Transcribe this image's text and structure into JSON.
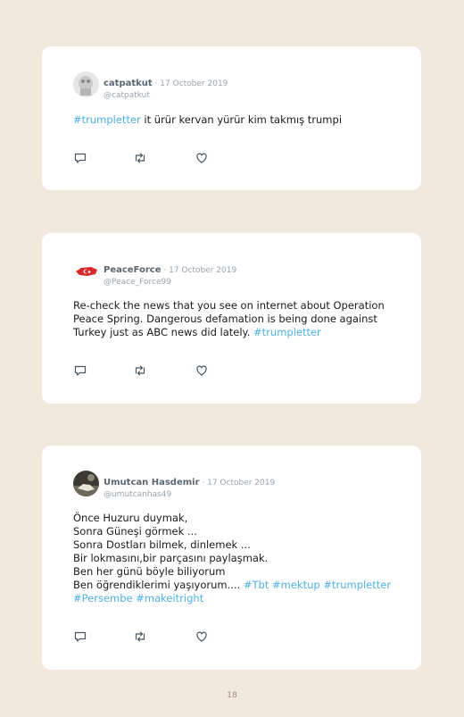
{
  "tweets": [
    {
      "name": "catpatkut",
      "sep": " · ",
      "date": "17 October 2019",
      "handle": "@catpatkut",
      "lines": [
        [
          {
            "t": "#trumpletter",
            "h": true
          },
          {
            "t": " it ürür kervan yürür kim takmış trumpi",
            "h": false
          }
        ]
      ]
    },
    {
      "name": "PeaceForce",
      "sep": " · ",
      "date": "17 October 2019",
      "handle": "@Peace_Force99",
      "lines": [
        [
          {
            "t": "Re-check the news that you see on internet about Operation",
            "h": false
          }
        ],
        [
          {
            "t": "Peace Spring. Dangerous defamation is being done against",
            "h": false
          }
        ],
        [
          {
            "t": "Turkey just as ABC news did lately. ",
            "h": false
          },
          {
            "t": "#trumpletter",
            "h": true
          }
        ]
      ]
    },
    {
      "name": "Umutcan Hasdemir",
      "sep": " · ",
      "date": "17 October 2019",
      "handle": "@umutcanhas49",
      "lines": [
        [
          {
            "t": "Önce Huzuru duymak,",
            "h": false
          }
        ],
        [
          {
            "t": "Sonra Güneşi görmek ...",
            "h": false
          }
        ],
        [
          {
            "t": "Sonra Dostları bilmek, dinlemek ...",
            "h": false
          }
        ],
        [
          {
            "t": "Bir lokmasını,bir parçasını paylaşmak.",
            "h": false
          }
        ],
        [
          {
            "t": "Ben her günü böyle biliyorum",
            "h": false
          }
        ],
        [
          {
            "t": "Ben öğrendiklerimi yaşıyorum.... ",
            "h": false
          },
          {
            "t": "#Tbt #mektup #trumpletter",
            "h": true
          }
        ],
        [
          {
            "t": "#Persembe #makeitright",
            "h": true
          }
        ]
      ]
    }
  ],
  "icons": {
    "reply": "reply-icon",
    "retweet": "retweet-icon",
    "like": "heart-icon"
  },
  "colors": {
    "background": "#f2e8de",
    "card": "#ffffff",
    "hashtag": "#4fb0e8",
    "meta": "#9aa4ad"
  },
  "page_number": "18"
}
